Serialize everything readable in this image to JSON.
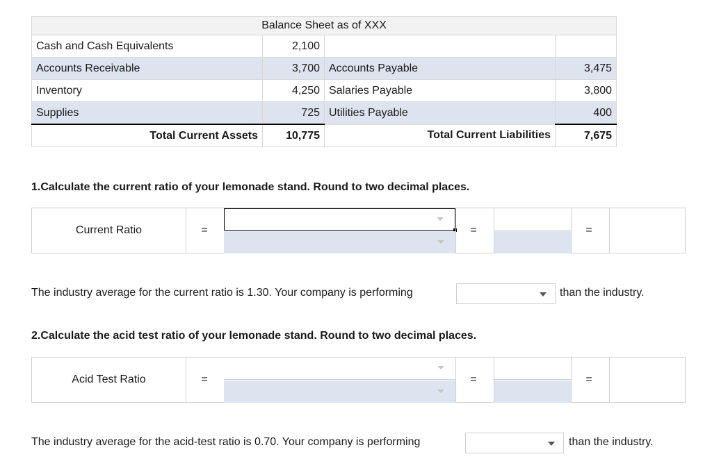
{
  "balance_sheet": {
    "title": "Balance Sheet as of XXX",
    "rows": [
      {
        "asset": "Cash and Cash Equivalents",
        "asset_value": "2,100",
        "liability": "",
        "liability_value": ""
      },
      {
        "asset": "Accounts Receivable",
        "asset_value": "3,700",
        "liability": "Accounts Payable",
        "liability_value": "3,475"
      },
      {
        "asset": "Inventory",
        "asset_value": "4,250",
        "liability": "Salaries Payable",
        "liability_value": "3,800"
      },
      {
        "asset": "Supplies",
        "asset_value": "725",
        "liability": "Utilities Payable",
        "liability_value": "400"
      }
    ],
    "total_assets_label": "Total Current Assets",
    "total_assets_value": "10,775",
    "total_liabilities_label": "Total Current Liabilities",
    "total_liabilities_value": "7,675"
  },
  "q1": {
    "question": "1.Calculate the current ratio of your lemonade stand. Round to two decimal places.",
    "label": "Current Ratio",
    "eq": "=",
    "sentence": "The industry average for the current ratio is 1.30. Your company is performing",
    "after": "than the industry."
  },
  "q2": {
    "question": "2.Calculate the acid test ratio of your lemonade stand. Round to two decimal places.",
    "label": "Acid Test Ratio",
    "eq": "=",
    "sentence": "The industry average for the acid-test ratio is 0.70. Your company is performing",
    "after": "than the industry."
  },
  "colors": {
    "shade": "#dde4f0",
    "title_bg": "#f2f2f2",
    "border": "#d8d8d8"
  }
}
